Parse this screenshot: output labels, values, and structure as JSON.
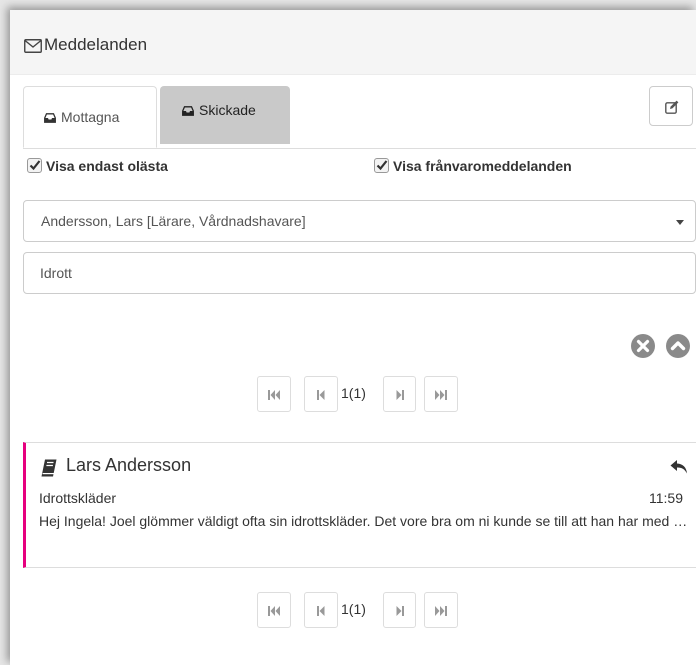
{
  "header": {
    "title": "Meddelanden",
    "icon": "envelope-icon"
  },
  "tabs": [
    {
      "label": "Mottagna",
      "icon": "inbox-tray-icon",
      "active": true
    },
    {
      "label": "Skickade",
      "icon": "inbox-tray-icon",
      "active": false
    }
  ],
  "toolbar": {
    "compose_icon": "compose-edit-icon"
  },
  "filters": {
    "unread_only": {
      "label": "Visa endast olästa",
      "checked": true
    },
    "show_absence": {
      "label": "Visa frånvaromeddelanden",
      "checked": true
    }
  },
  "recipient_select": {
    "value": "Andersson, Lars [Lärare, Vårdnadshavare]"
  },
  "search": {
    "value": "Idrott"
  },
  "search_actions": {
    "clear_icon": "close-circle-icon",
    "collapse_icon": "chevron-up-circle-icon"
  },
  "pagination": {
    "page_info": "1(1)",
    "current": 1,
    "total": 1
  },
  "messages": [
    {
      "sender": "Lars Andersson",
      "subject": "Idrottskläder",
      "time": "11:59",
      "preview": "Hej Ingela! Joel glömmer väldigt ofta sin idrottskläder. Det vore bra om ni kunde se till att han har med sig dem varje gång.",
      "accent_color": "#e6007e",
      "icon": "book-icon",
      "reply_icon": "reply-icon"
    }
  ],
  "colors": {
    "accent": "#e6007e",
    "tab_inactive": "#c9c9c9",
    "icon_grey": "#8a8a8a"
  }
}
